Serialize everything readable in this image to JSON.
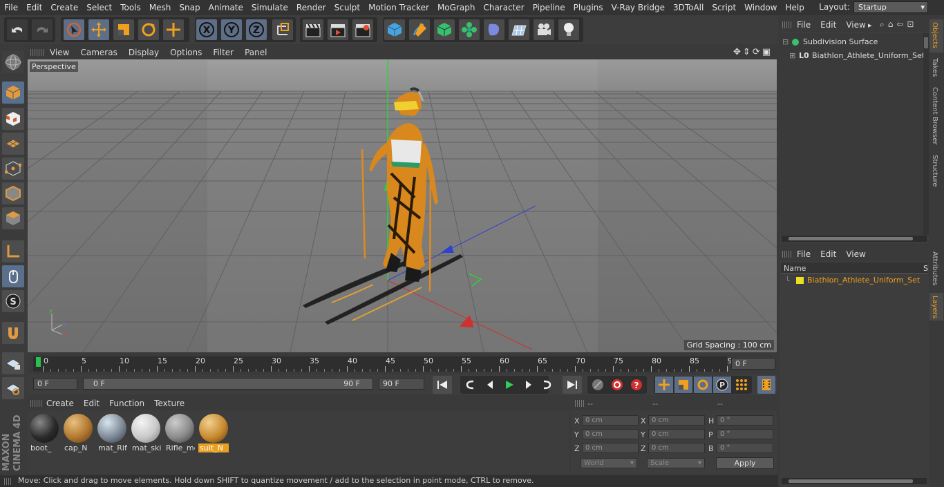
{
  "menubar": {
    "items": [
      "File",
      "Edit",
      "Create",
      "Select",
      "Tools",
      "Mesh",
      "Snap",
      "Animate",
      "Simulate",
      "Render",
      "Sculpt",
      "Motion Tracker",
      "MoGraph",
      "Character",
      "Pipeline",
      "Plugins",
      "V-Ray Bridge",
      "3DToAll",
      "Script",
      "Window",
      "Help"
    ],
    "layout_label": "Layout:",
    "layout_value": "Startup"
  },
  "viewport": {
    "menu": [
      "View",
      "Cameras",
      "Display",
      "Options",
      "Filter",
      "Panel"
    ],
    "camera_label": "Perspective",
    "grid_spacing": "Grid Spacing : 100 cm"
  },
  "timeline": {
    "ticks": [
      "0",
      "5",
      "10",
      "15",
      "20",
      "25",
      "30",
      "35",
      "40",
      "45",
      "50",
      "55",
      "60",
      "65",
      "70",
      "75",
      "80",
      "85",
      "90"
    ],
    "current_frame": "0 F",
    "start_field": "0 F",
    "range_start": "0 F",
    "range_end": "90 F",
    "end_field": "90 F"
  },
  "materials": {
    "menu": [
      "Create",
      "Edit",
      "Function",
      "Texture"
    ],
    "items": [
      {
        "label": "boot_",
        "color": "#2a2a2a"
      },
      {
        "label": "cap_N",
        "color": "#b0772e"
      },
      {
        "label": "mat_Rifl",
        "color": "#7d8a96"
      },
      {
        "label": "mat_ski",
        "color": "#c9c9c9"
      },
      {
        "label": "Rifle_me",
        "color": "#8a8a8a"
      },
      {
        "label": "suit_N",
        "color": "#c88a2f"
      }
    ]
  },
  "coords": {
    "headers": [
      "--",
      "--",
      "--"
    ],
    "rows": [
      {
        "a": "X",
        "av": "0 cm",
        "b": "X",
        "bv": "0 cm",
        "c": "H",
        "cv": "0 °"
      },
      {
        "a": "Y",
        "av": "0 cm",
        "b": "Y",
        "bv": "0 cm",
        "c": "P",
        "cv": "0 °"
      },
      {
        "a": "Z",
        "av": "0 cm",
        "b": "Z",
        "bv": "0 cm",
        "c": "B",
        "cv": "0 °"
      }
    ],
    "world": "World",
    "scale": "Scale",
    "apply": "Apply"
  },
  "status": "Move: Click and drag to move elements. Hold down SHIFT to quantize movement / add to the selection in point mode, CTRL to remove.",
  "objects": {
    "menu": [
      "File",
      "Edit",
      "View"
    ],
    "items": [
      {
        "name": "Subdivision Surface"
      },
      {
        "name": "Biathlon_Athlete_Uniform_Set"
      }
    ]
  },
  "layers": {
    "menu": [
      "File",
      "Edit",
      "View"
    ],
    "col_name": "Name",
    "col_s": "S",
    "item": "Biathlon_Athlete_Uniform_Set"
  },
  "sidetabs": [
    "Objects",
    "Takes",
    "Content Browser",
    "Structure",
    "Attributes",
    "Layers"
  ],
  "brand": "MAXON CINEMA 4D"
}
